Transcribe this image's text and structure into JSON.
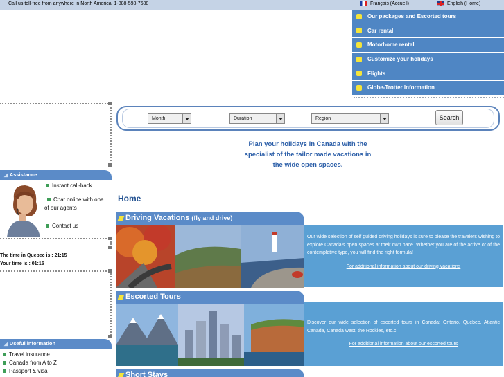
{
  "header": {
    "tollfree": "Call us toll-free from anywhere in North America: 1-888-598-7688",
    "lang_fr": "Français (Accueil)",
    "lang_en": "English (Home)"
  },
  "nav": {
    "items": [
      {
        "label": "Our packages and Escorted tours"
      },
      {
        "label": "Car rental"
      },
      {
        "label": "Motorhome rental"
      },
      {
        "label": "Customize your holidays"
      },
      {
        "label": "Flights"
      },
      {
        "label": "Globe-Trotter Information"
      }
    ]
  },
  "search": {
    "month": "Month",
    "duration": "Duration",
    "region": "Region",
    "button": "Search"
  },
  "tagline": {
    "line1": "Plan your holidays in Canada with the",
    "line2": "specialist of the tailor made vacations in",
    "line3": "the wide open spaces."
  },
  "assistance": {
    "title": "Assistance",
    "callback": "Instant call-back",
    "chat_line1": "Chat online with one",
    "chat_line2": "of our agents",
    "contact": "Contact us"
  },
  "time": {
    "quebec": "The time in Quebec is : 21:15",
    "yours": "Your time is : 01:15"
  },
  "useful": {
    "title": "Useful information",
    "items": [
      "Travel insurance",
      "Canada from A to Z",
      "Passport & visa"
    ]
  },
  "main": {
    "home_title": "Home",
    "sections": [
      {
        "title": "Driving Vacations",
        "subtitle": "(fly and drive)",
        "text": "Our wide selection of self guided driving holidays is sure to please the travelers wishing to explore Canada's open spaces at their own pace. Whether you are of the active or of the contemplative type, you will find the right formula!",
        "link": "For additional information about our driving vacations"
      },
      {
        "title": "Escorted Tours",
        "subtitle": "",
        "text": "Discover our wide selection of escorted tours in Canada: Ontario, Quebec, Atlantic Canada, Canada west, the Rockies, etc.c.",
        "link": "For additional information about our escorted tours"
      },
      {
        "title": "Short Stays",
        "subtitle": ""
      }
    ]
  },
  "colors": {
    "accent_blue": "#5b8bc8",
    "nav_blue": "#4f86c4",
    "text_panel": "#5aa0d4",
    "bullet_yellow": "#f5e43a"
  }
}
